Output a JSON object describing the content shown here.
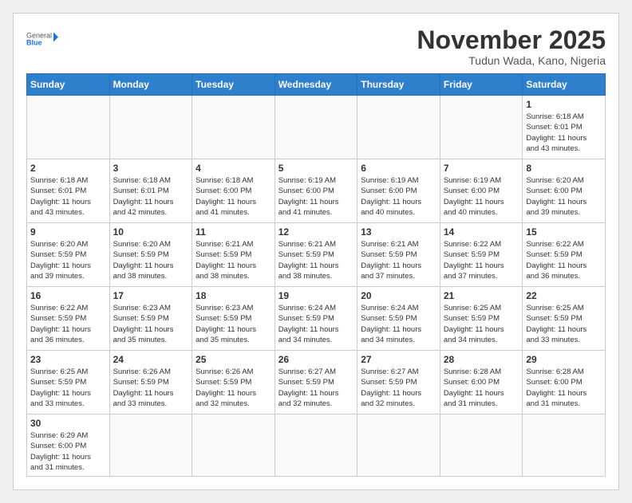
{
  "header": {
    "logo_general": "General",
    "logo_blue": "Blue",
    "month_title": "November 2025",
    "location": "Tudun Wada, Kano, Nigeria"
  },
  "weekdays": [
    "Sunday",
    "Monday",
    "Tuesday",
    "Wednesday",
    "Thursday",
    "Friday",
    "Saturday"
  ],
  "weeks": [
    [
      {
        "day": "",
        "info": ""
      },
      {
        "day": "",
        "info": ""
      },
      {
        "day": "",
        "info": ""
      },
      {
        "day": "",
        "info": ""
      },
      {
        "day": "",
        "info": ""
      },
      {
        "day": "",
        "info": ""
      },
      {
        "day": "1",
        "info": "Sunrise: 6:18 AM\nSunset: 6:01 PM\nDaylight: 11 hours\nand 43 minutes."
      }
    ],
    [
      {
        "day": "2",
        "info": "Sunrise: 6:18 AM\nSunset: 6:01 PM\nDaylight: 11 hours\nand 43 minutes."
      },
      {
        "day": "3",
        "info": "Sunrise: 6:18 AM\nSunset: 6:01 PM\nDaylight: 11 hours\nand 42 minutes."
      },
      {
        "day": "4",
        "info": "Sunrise: 6:18 AM\nSunset: 6:00 PM\nDaylight: 11 hours\nand 41 minutes."
      },
      {
        "day": "5",
        "info": "Sunrise: 6:19 AM\nSunset: 6:00 PM\nDaylight: 11 hours\nand 41 minutes."
      },
      {
        "day": "6",
        "info": "Sunrise: 6:19 AM\nSunset: 6:00 PM\nDaylight: 11 hours\nand 40 minutes."
      },
      {
        "day": "7",
        "info": "Sunrise: 6:19 AM\nSunset: 6:00 PM\nDaylight: 11 hours\nand 40 minutes."
      },
      {
        "day": "8",
        "info": "Sunrise: 6:20 AM\nSunset: 6:00 PM\nDaylight: 11 hours\nand 39 minutes."
      }
    ],
    [
      {
        "day": "9",
        "info": "Sunrise: 6:20 AM\nSunset: 5:59 PM\nDaylight: 11 hours\nand 39 minutes."
      },
      {
        "day": "10",
        "info": "Sunrise: 6:20 AM\nSunset: 5:59 PM\nDaylight: 11 hours\nand 38 minutes."
      },
      {
        "day": "11",
        "info": "Sunrise: 6:21 AM\nSunset: 5:59 PM\nDaylight: 11 hours\nand 38 minutes."
      },
      {
        "day": "12",
        "info": "Sunrise: 6:21 AM\nSunset: 5:59 PM\nDaylight: 11 hours\nand 38 minutes."
      },
      {
        "day": "13",
        "info": "Sunrise: 6:21 AM\nSunset: 5:59 PM\nDaylight: 11 hours\nand 37 minutes."
      },
      {
        "day": "14",
        "info": "Sunrise: 6:22 AM\nSunset: 5:59 PM\nDaylight: 11 hours\nand 37 minutes."
      },
      {
        "day": "15",
        "info": "Sunrise: 6:22 AM\nSunset: 5:59 PM\nDaylight: 11 hours\nand 36 minutes."
      }
    ],
    [
      {
        "day": "16",
        "info": "Sunrise: 6:22 AM\nSunset: 5:59 PM\nDaylight: 11 hours\nand 36 minutes."
      },
      {
        "day": "17",
        "info": "Sunrise: 6:23 AM\nSunset: 5:59 PM\nDaylight: 11 hours\nand 35 minutes."
      },
      {
        "day": "18",
        "info": "Sunrise: 6:23 AM\nSunset: 5:59 PM\nDaylight: 11 hours\nand 35 minutes."
      },
      {
        "day": "19",
        "info": "Sunrise: 6:24 AM\nSunset: 5:59 PM\nDaylight: 11 hours\nand 34 minutes."
      },
      {
        "day": "20",
        "info": "Sunrise: 6:24 AM\nSunset: 5:59 PM\nDaylight: 11 hours\nand 34 minutes."
      },
      {
        "day": "21",
        "info": "Sunrise: 6:25 AM\nSunset: 5:59 PM\nDaylight: 11 hours\nand 34 minutes."
      },
      {
        "day": "22",
        "info": "Sunrise: 6:25 AM\nSunset: 5:59 PM\nDaylight: 11 hours\nand 33 minutes."
      }
    ],
    [
      {
        "day": "23",
        "info": "Sunrise: 6:25 AM\nSunset: 5:59 PM\nDaylight: 11 hours\nand 33 minutes."
      },
      {
        "day": "24",
        "info": "Sunrise: 6:26 AM\nSunset: 5:59 PM\nDaylight: 11 hours\nand 33 minutes."
      },
      {
        "day": "25",
        "info": "Sunrise: 6:26 AM\nSunset: 5:59 PM\nDaylight: 11 hours\nand 32 minutes."
      },
      {
        "day": "26",
        "info": "Sunrise: 6:27 AM\nSunset: 5:59 PM\nDaylight: 11 hours\nand 32 minutes."
      },
      {
        "day": "27",
        "info": "Sunrise: 6:27 AM\nSunset: 5:59 PM\nDaylight: 11 hours\nand 32 minutes."
      },
      {
        "day": "28",
        "info": "Sunrise: 6:28 AM\nSunset: 6:00 PM\nDaylight: 11 hours\nand 31 minutes."
      },
      {
        "day": "29",
        "info": "Sunrise: 6:28 AM\nSunset: 6:00 PM\nDaylight: 11 hours\nand 31 minutes."
      }
    ],
    [
      {
        "day": "30",
        "info": "Sunrise: 6:29 AM\nSunset: 6:00 PM\nDaylight: 11 hours\nand 31 minutes."
      },
      {
        "day": "",
        "info": ""
      },
      {
        "day": "",
        "info": ""
      },
      {
        "day": "",
        "info": ""
      },
      {
        "day": "",
        "info": ""
      },
      {
        "day": "",
        "info": ""
      },
      {
        "day": "",
        "info": ""
      }
    ]
  ]
}
